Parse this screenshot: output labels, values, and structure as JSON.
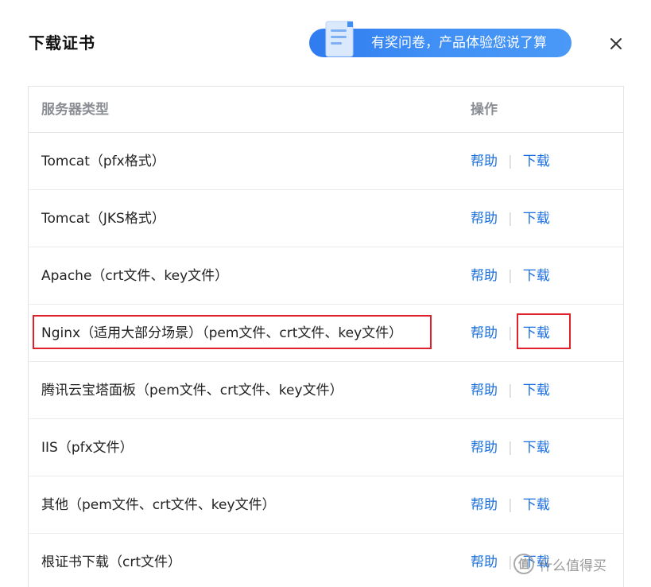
{
  "dialog": {
    "title": "下载证书",
    "close_glyph": "×"
  },
  "survey": {
    "text": "有奖问卷，产品体验您说了算",
    "icon": "document-icon",
    "gradient_start": "#2f7bf0",
    "gradient_end": "#4a99f7"
  },
  "table": {
    "headers": {
      "type": "服务器类型",
      "action": "操作"
    },
    "rows": [
      {
        "type": "Tomcat（pfx格式）",
        "help": "帮助",
        "sep": "|",
        "download": "下载"
      },
      {
        "type": "Tomcat（JKS格式）",
        "help": "帮助",
        "sep": "|",
        "download": "下载"
      },
      {
        "type": "Apache（crt文件、key文件）",
        "help": "帮助",
        "sep": "|",
        "download": "下载"
      },
      {
        "type": "Nginx（适用大部分场景）（pem文件、crt文件、key文件）",
        "help": "帮助",
        "sep": "|",
        "download": "下载"
      },
      {
        "type": "腾讯云宝塔面板（pem文件、crt文件、key文件）",
        "help": "帮助",
        "sep": "|",
        "download": "下载"
      },
      {
        "type": "IIS（pfx文件）",
        "help": "帮助",
        "sep": "|",
        "download": "下载"
      },
      {
        "type": "其他（pem文件、crt文件、key文件）",
        "help": "帮助",
        "sep": "|",
        "download": "下载"
      },
      {
        "type": "根证书下载（crt文件）",
        "help": "帮助",
        "sep": "|",
        "download": "下载"
      }
    ]
  },
  "colors": {
    "link": "#1a6fe0",
    "highlight": "#e0202a",
    "header_text": "#8a8d93"
  },
  "watermark": {
    "icon_glyph": "值",
    "text": "什么值得买"
  }
}
